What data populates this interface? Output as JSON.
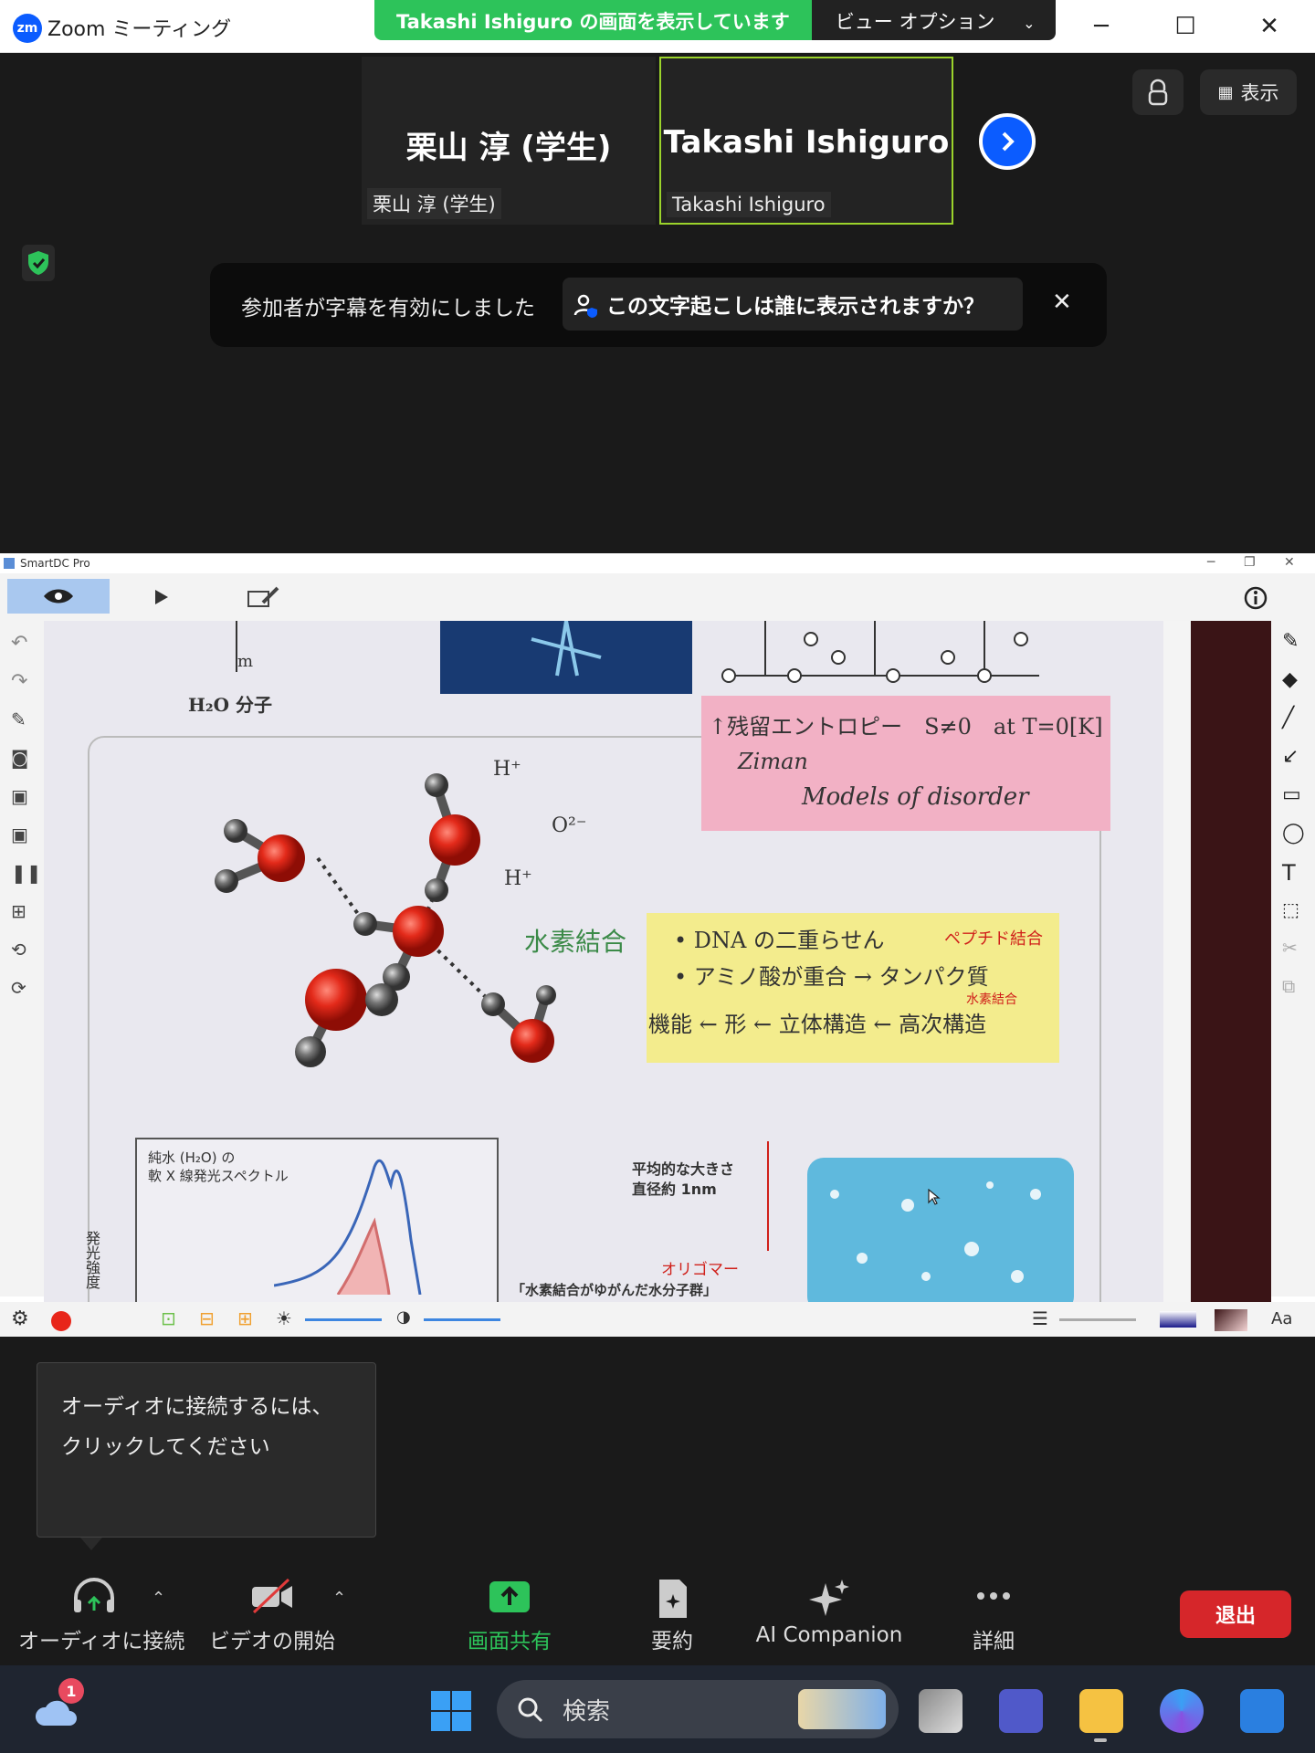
{
  "window": {
    "app_title": "Zoom ミーティング",
    "logo_text": "zm",
    "share_banner": "Takashi Ishiguro の画面を表示しています",
    "view_options": "ビュー オプション",
    "controls": {
      "minimize": "─",
      "maximize": "☐",
      "close": "✕"
    }
  },
  "participants": [
    {
      "display": "栗山 淳 (学生)",
      "label": "栗山 淳 (学生)",
      "active": false
    },
    {
      "display": "Takashi Ishiguro",
      "label": "Takashi Ishiguro",
      "active": true
    }
  ],
  "header_buttons": {
    "view_label": "表示"
  },
  "caption_toast": {
    "message": "参加者が字幕を有効にしました",
    "link": "この文字起こしは誰に表示されますか？",
    "close": "✕"
  },
  "shared_app": {
    "title": "SmartDC Pro",
    "controls": {
      "minimize": "─",
      "restore": "❐",
      "close": "✕"
    },
    "doc": {
      "h2o_label": "H₂O 分子",
      "m_label": "m",
      "pink_note": {
        "line1": "↑残留エントロピー　S≠0　at T=0[K]",
        "line2": "Ziman",
        "line3": "Models of disorder"
      },
      "hydrogen_bond": "水素結合",
      "yellow_note": {
        "line1": "• DNA の二重らせん",
        "line2": "• アミノ酸が重合 → タンパク質",
        "line3": "機能 ← 形 ← 立体構造 ← 高次構造",
        "red1": "ペプチド結合",
        "red2": "水素結合"
      },
      "ion_labels": [
        "H⁺",
        "O²⁻",
        "H⁺"
      ],
      "spectrum_label": "純水 (H₂O) の\n軟 X 線発光スペクトル",
      "spectrum_axis": "発光強度",
      "size_label": "平均的な大きさ\n直径約 1nm",
      "oligomer": "オリゴマー",
      "caption": "「水素結合がゆがんだ水分子群」"
    },
    "bottom_text": "Aa"
  },
  "tooltip": {
    "text": "オーディオに接続するには、クリックしてください"
  },
  "controls": {
    "audio": "オーディオに接続",
    "video": "ビデオの開始",
    "share": "画面共有",
    "summary": "要約",
    "ai": "AI Companion",
    "more": "詳細",
    "leave": "退出"
  },
  "taskbar": {
    "search_placeholder": "検索",
    "weather_badge": "1"
  },
  "colors": {
    "zoom_blue": "#0b5cff",
    "share_green": "#2dc35a",
    "leave_red": "#d6262a",
    "active_border": "#9bd32b"
  }
}
